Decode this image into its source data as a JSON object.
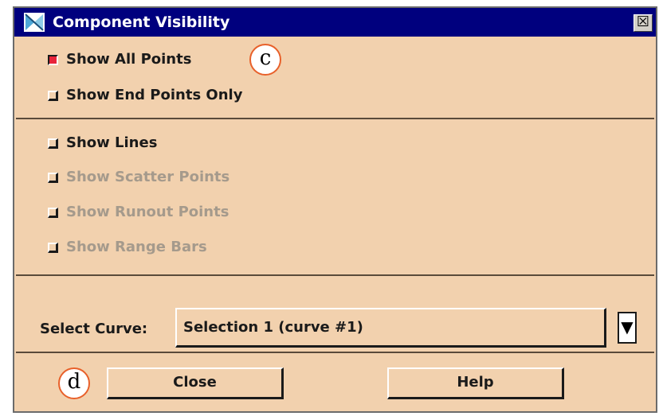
{
  "window": {
    "title": "Component Visibility",
    "close_glyph": "☒",
    "icon": "dialog-app-icon"
  },
  "points_group": [
    {
      "label": "Show All Points",
      "checked": true,
      "enabled": true
    },
    {
      "label": "Show End Points Only",
      "checked": false,
      "enabled": true
    }
  ],
  "components_group": [
    {
      "label": "Show Lines",
      "checked": false,
      "enabled": true
    },
    {
      "label": "Show Scatter Points",
      "checked": false,
      "enabled": false
    },
    {
      "label": "Show Runout Points",
      "checked": false,
      "enabled": false
    },
    {
      "label": "Show Range Bars",
      "checked": false,
      "enabled": false
    }
  ],
  "curve": {
    "label": "Select Curve:",
    "value": "Selection 1 (curve #1)",
    "dropdown_glyph": "▼"
  },
  "buttons": {
    "close": "Close",
    "help": "Help"
  },
  "annotations": {
    "c": "c",
    "d": "d"
  },
  "colors": {
    "background": "#f2d1ae",
    "titlebar": "#00007e",
    "checked": "#e8243a",
    "callout_border": "#e8602a"
  }
}
